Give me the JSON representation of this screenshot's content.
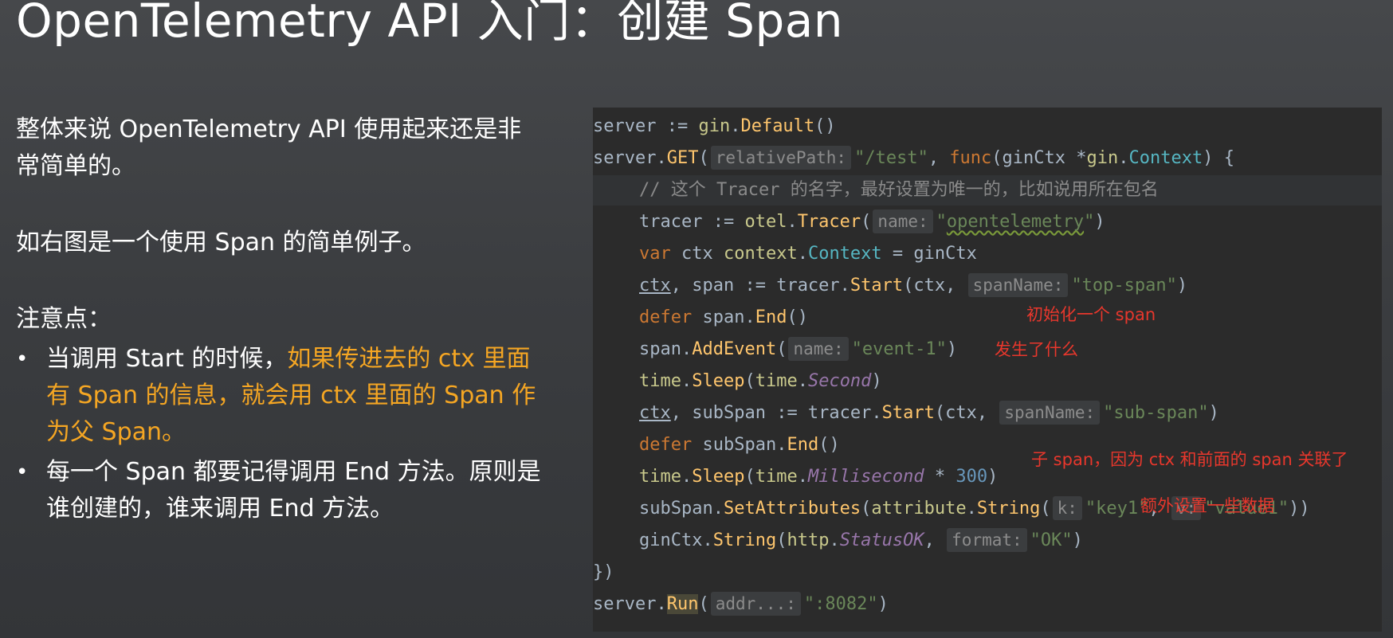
{
  "slide": {
    "title": "OpenTelemetry API 入门：创建 Span",
    "intro": "整体来说 OpenTelemetry API 使用起来还是非常简单的。",
    "example_note": "如右图是一个使用 Span 的简单例子。",
    "notes_heading": "注意点：",
    "bullet_symbol": "•",
    "bullets": [
      {
        "prefix": "当调用 Start 的时候，",
        "highlight": "如果传进去的 ctx 里面有 Span 的信息，就会用 ctx 里面的 Span 作为父 Span。"
      },
      {
        "text": "每一个 Span 都要记得调用 End 方法。原则是谁创建的，谁来调用 End 方法。"
      }
    ]
  },
  "code": {
    "line1": {
      "a": "server := ",
      "b": "gin",
      "c": ".",
      "d": "Default",
      "e": "()"
    },
    "line2": {
      "a": "server.",
      "b": "GET",
      "c": "(",
      "hint": "relativePath:",
      "str": "\"/test\"",
      "d": ", ",
      "kw": "func",
      "e": "(ginCtx *",
      "pkg": "gin",
      "f": ".",
      "type": "Context",
      "g": ") {"
    },
    "line3": {
      "comment": "// 这个 Tracer 的名字，最好设置为唯一的，比如说用所在包名"
    },
    "line4": {
      "a": "tracer := ",
      "pkg": "otel",
      "b": ".",
      "fn": "Tracer",
      "c": "(",
      "hint": "name:",
      "q1": "\"",
      "str": "opentelemetry",
      "q2": "\"",
      "d": ")"
    },
    "line5": {
      "kw": "var",
      "a": " ctx ",
      "pkg": "context",
      "b": ".",
      "type": "Context",
      "c": " = ginCtx"
    },
    "line6": {
      "ctx": "ctx",
      "a": ", span := tracer.",
      "fn": "Start",
      "b": "(ctx, ",
      "hint": "spanName:",
      "str": "\"top-span\"",
      "c": ")"
    },
    "line7": {
      "kw": "defer",
      "a": " span.",
      "fn": "End",
      "b": "()"
    },
    "line8": {
      "a": "span.",
      "fn": "AddEvent",
      "b": "(",
      "hint": "name:",
      "str": "\"event-1\"",
      "c": ")"
    },
    "line9": {
      "pkg1": "time",
      "a": ".",
      "fn": "Sleep",
      "b": "(",
      "pkg2": "time",
      "c": ".",
      "const": "Second",
      "d": ")"
    },
    "line10": {
      "ctx": "ctx",
      "a": ", subSpan := tracer.",
      "fn": "Start",
      "b": "(ctx, ",
      "hint": "spanName:",
      "str": "\"sub-span\"",
      "c": ")"
    },
    "line11": {
      "kw": "defer",
      "a": " subSpan.",
      "fn": "End",
      "b": "()"
    },
    "line12": {
      "pkg1": "time",
      "a": ".",
      "fn": "Sleep",
      "b": "(",
      "pkg2": "time",
      "c": ".",
      "const": "Millisecond",
      "d": " * ",
      "num": "300",
      "e": ")"
    },
    "line13": {
      "a": "subSpan.",
      "fn": "SetAttributes",
      "b": "(",
      "pkg": "attribute",
      "c": ".",
      "fn2": "String",
      "d": "(",
      "hint1": "k:",
      "str1": "\"key1\"",
      "e": ", ",
      "hint2": "v:",
      "str2": "\"value1\"",
      "f": "))"
    },
    "line14": {
      "a": "ginCtx.",
      "fn": "String",
      "b": "(",
      "pkg": "http",
      "c": ".",
      "const": "StatusOK",
      "d": ", ",
      "hint": "format:",
      "str": "\"OK\"",
      "e": ")"
    },
    "line15": {
      "a": "})"
    },
    "line16": {
      "a": "server.",
      "fn": "Run",
      "b": "(",
      "hint": "addr...:",
      "str": "\":8082\"",
      "c": ")"
    }
  },
  "annotations": {
    "init_span": "初始化一个 span",
    "what_happened": "发生了什么",
    "sub_span": "子 span，因为 ctx 和前面的 span 关联了",
    "extra_data": "额外设置一些数据"
  },
  "colors": {
    "annotation": "#e8372c",
    "highlight": "#f5a623",
    "code_bg": "#2b2b2b"
  }
}
